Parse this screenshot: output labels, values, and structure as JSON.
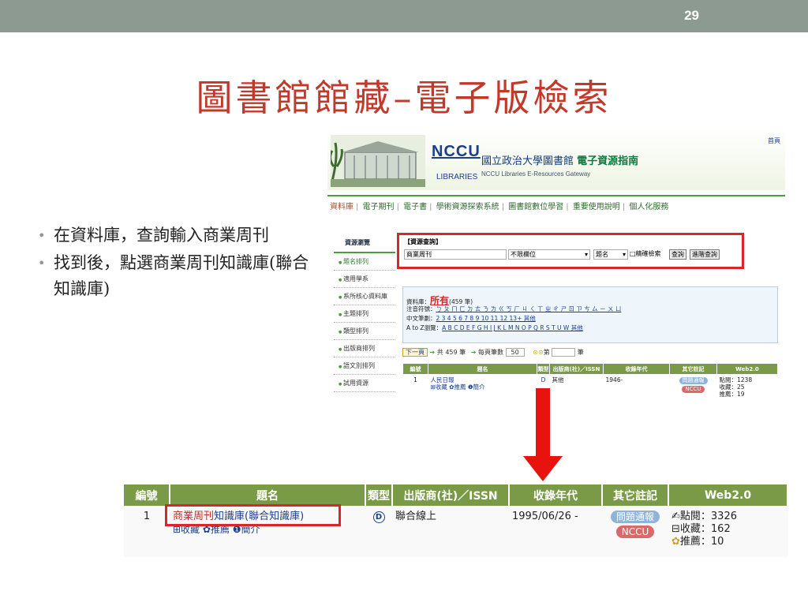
{
  "slide": {
    "number": "29",
    "title": "圖書館館藏–電子版檢索"
  },
  "bullets": [
    "在資料庫，查詢輸入商業周刊",
    "找到後，點選商業周刊知識庫(聯合知識庫)"
  ],
  "screenshot": {
    "home_link": "首頁",
    "logo": "NCCU",
    "logo_sub": "LIBRARIES",
    "banner_title_a": "國立政治大學圖書館 ",
    "banner_title_b": "電子資源指南",
    "banner_en": "NCCU Libraries E-Resources Gateway",
    "nav": [
      "資料庫",
      "電子期刊",
      "電子書",
      "學術資源探索系統",
      "圖書館數位學習",
      "重要使用說明",
      "個人化服務"
    ],
    "sidebar_title": "資源瀏覽",
    "sidebar": [
      "題名排列",
      "適用學系",
      "系所核心資料庫",
      "主題排列",
      "類型排列",
      "出版商排列",
      "語文別排列",
      "試用資源"
    ],
    "query": {
      "title": "【資源查詢】",
      "input_value": "商業周刊",
      "field_select": "不限欄位",
      "type_select": "題名",
      "exact_label": "□精確檢索",
      "search_btn": "查詢",
      "advanced_btn": "進階查詢"
    },
    "db": {
      "label": "資料庫：",
      "all": "所有",
      "count": "(459 筆)",
      "zhuyin_label": "注音符號：",
      "zhuyin": "ㄅ ㄆ ㄇ ㄈ ㄉ ㄊ ㄋ ㄌ ㄍ ㄎ ㄏ ㄐ ㄑ ㄒ ㄓ ㄔ ㄕ ㄖ ㄗ ㄘ ㄙ ㄧ ㄨ ㄩ",
      "strokes_label": "中文筆劃：",
      "strokes": "2 3 4 5 6 7 8 9 10 11 12 13+ 其他",
      "az_label": "A to Z瀏覽：",
      "az": "A B C D E F G H I J K L M N O P Q R S T U W 其他"
    },
    "pager": {
      "next": "下一頁",
      "total": "共 459 筆",
      "per_page_label": "每頁筆數",
      "per_page": "50",
      "page_label": "第",
      "page_suffix": "筆"
    },
    "table": {
      "headers": [
        "編號",
        "題名",
        "類型",
        "出版商(社)／ISSN",
        "收錄年代",
        "其它註記",
        "Web2.0"
      ],
      "row": {
        "num": "1",
        "title": "人民日報",
        "actions": "⊞收藏 ✿推薦 ❶簡介",
        "type_icon": "D",
        "publisher": "其他",
        "years": "1946-",
        "pill1": "問題通報",
        "pill2": "NCCU",
        "views": "點閱：1238",
        "favs": "收藏：25",
        "recs": "推薦：19"
      }
    }
  },
  "result": {
    "headers": [
      "編號",
      "題名",
      "類型",
      "出版商(社)／ISSN",
      "收錄年代",
      "其它註記",
      "Web2.0"
    ],
    "num": "1",
    "title_hl": "商業周刊",
    "title_rest": "知識庫(聯合知識庫)",
    "actions": "⊞收藏 ✿推薦 ❶簡介",
    "type_icon": "D",
    "publisher": "聯合線上",
    "years": "1995/06/26 -",
    "pill1": "問題通報",
    "pill2": "NCCU",
    "views": "點閱：3326",
    "favs": "收藏：162",
    "recs": "推薦：10"
  },
  "colors": {
    "title": "#c0392b",
    "header_green": "#7a9a48",
    "highlight_red": "#d9262c",
    "topbar": "#8c9a92"
  }
}
